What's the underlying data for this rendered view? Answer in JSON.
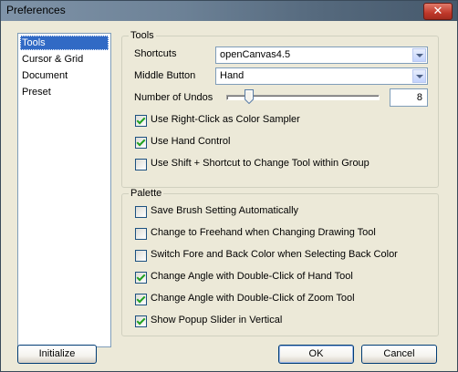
{
  "window": {
    "title": "Preferences",
    "close_glyph": "✕"
  },
  "nav": {
    "items": [
      {
        "label": "Tools",
        "selected": true
      },
      {
        "label": "Cursor & Grid",
        "selected": false
      },
      {
        "label": "Document",
        "selected": false
      },
      {
        "label": "Preset",
        "selected": false
      }
    ]
  },
  "tools": {
    "group_label": "Tools",
    "shortcuts": {
      "label": "Shortcuts",
      "value": "openCanvas4.5"
    },
    "middle_button": {
      "label": "Middle Button",
      "value": "Hand"
    },
    "undos": {
      "label": "Number of Undos",
      "value": "8",
      "slider_fraction": 0.13
    },
    "checkboxes": [
      {
        "label": "Use Right-Click as Color Sampler",
        "checked": true
      },
      {
        "label": "Use Hand Control",
        "checked": true
      },
      {
        "label": "Use Shift + Shortcut to Change Tool within Group",
        "checked": false
      }
    ]
  },
  "palette": {
    "group_label": "Palette",
    "checkboxes": [
      {
        "label": "Save Brush Setting Automatically",
        "checked": false
      },
      {
        "label": "Change to Freehand when Changing Drawing Tool",
        "checked": false
      },
      {
        "label": "Switch Fore and Back Color when Selecting Back Color",
        "checked": false
      },
      {
        "label": "Change Angle with Double-Click of Hand Tool",
        "checked": true
      },
      {
        "label": "Change Angle with Double-Click of Zoom Tool",
        "checked": true
      },
      {
        "label": "Show Popup Slider in Vertical",
        "checked": true
      }
    ]
  },
  "buttons": {
    "initialize": "Initialize",
    "ok": "OK",
    "cancel": "Cancel"
  }
}
